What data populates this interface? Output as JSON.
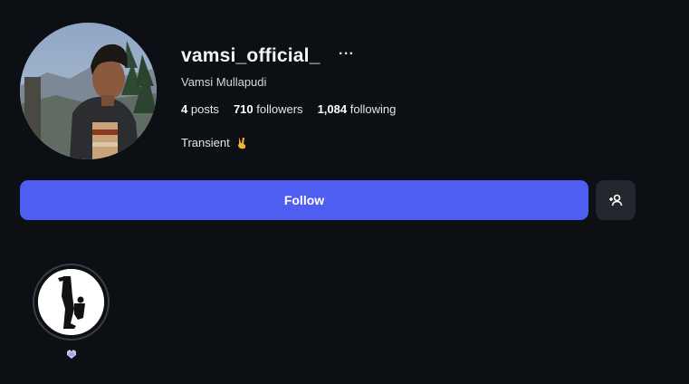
{
  "profile": {
    "username": "vamsi_official_",
    "more_label": "···",
    "full_name": "Vamsi Mullapudi",
    "stats": {
      "posts_count": "4",
      "posts_label": "posts",
      "followers_count": "710",
      "followers_label": "followers",
      "following_count": "1,084",
      "following_label": "following"
    },
    "bio": "Transient",
    "bio_emoji": "victory-hand-emoji"
  },
  "actions": {
    "follow_label": "Follow",
    "add_user_icon": "person-add-icon"
  },
  "highlights": [
    {
      "icon": "kick-silhouette",
      "label_icon": "small-emoji-icon"
    }
  ],
  "colors": {
    "background": "#0c0f14",
    "follow_button": "#4d5ef0",
    "secondary_button": "#24272d"
  }
}
